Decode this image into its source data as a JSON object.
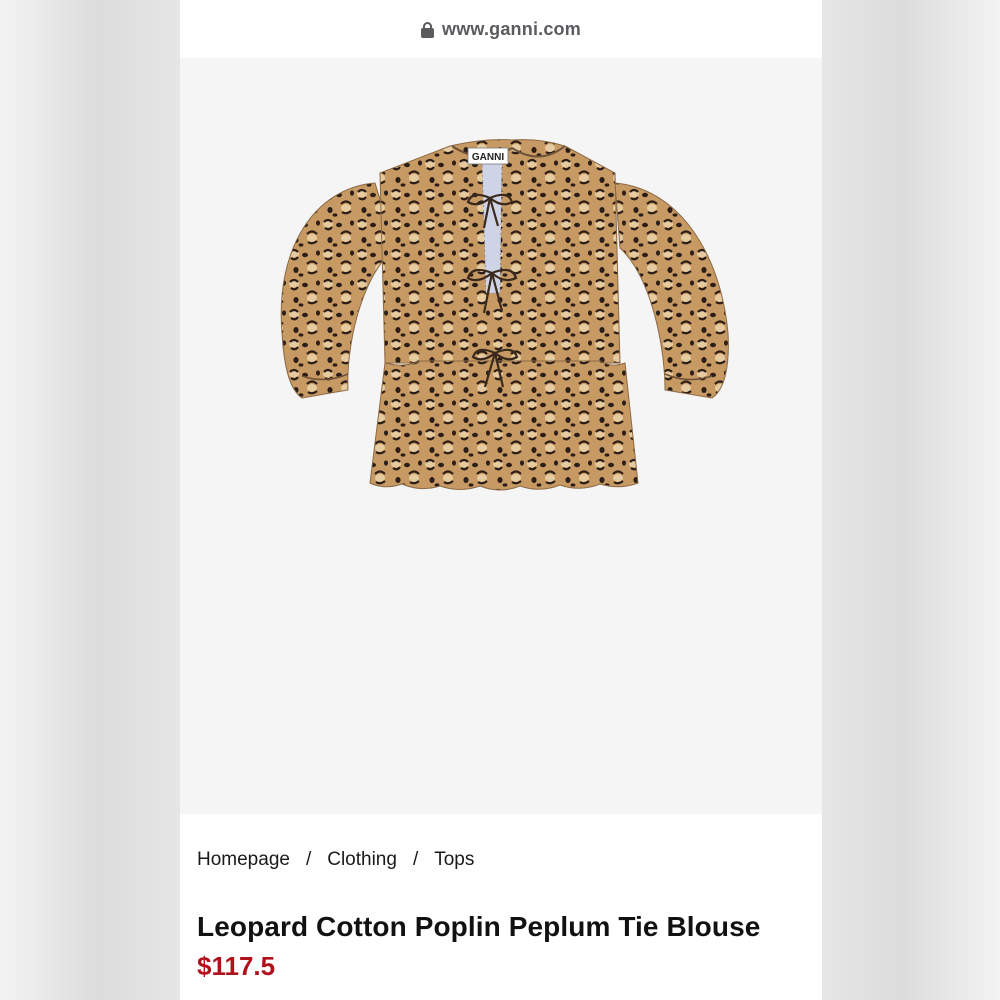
{
  "browser": {
    "url": "www.ganni.com",
    "lock_icon": "lock-icon"
  },
  "product_image": {
    "label_tag": "GANNI",
    "pattern": "leopard",
    "colors": {
      "base": "#c89a63",
      "light": "#e6cba0",
      "spot": "#2b1d17",
      "placket": "#cfd3e6"
    }
  },
  "breadcrumb": {
    "items": [
      "Homepage",
      "Clothing",
      "Tops"
    ],
    "separator": "/"
  },
  "product": {
    "title": "Leopard Cotton Poplin Peplum Tie Blouse",
    "price": "$117.5"
  },
  "colors": {
    "price": "#b0121b",
    "text": "#111111",
    "image_bg": "#f5f5f5"
  }
}
